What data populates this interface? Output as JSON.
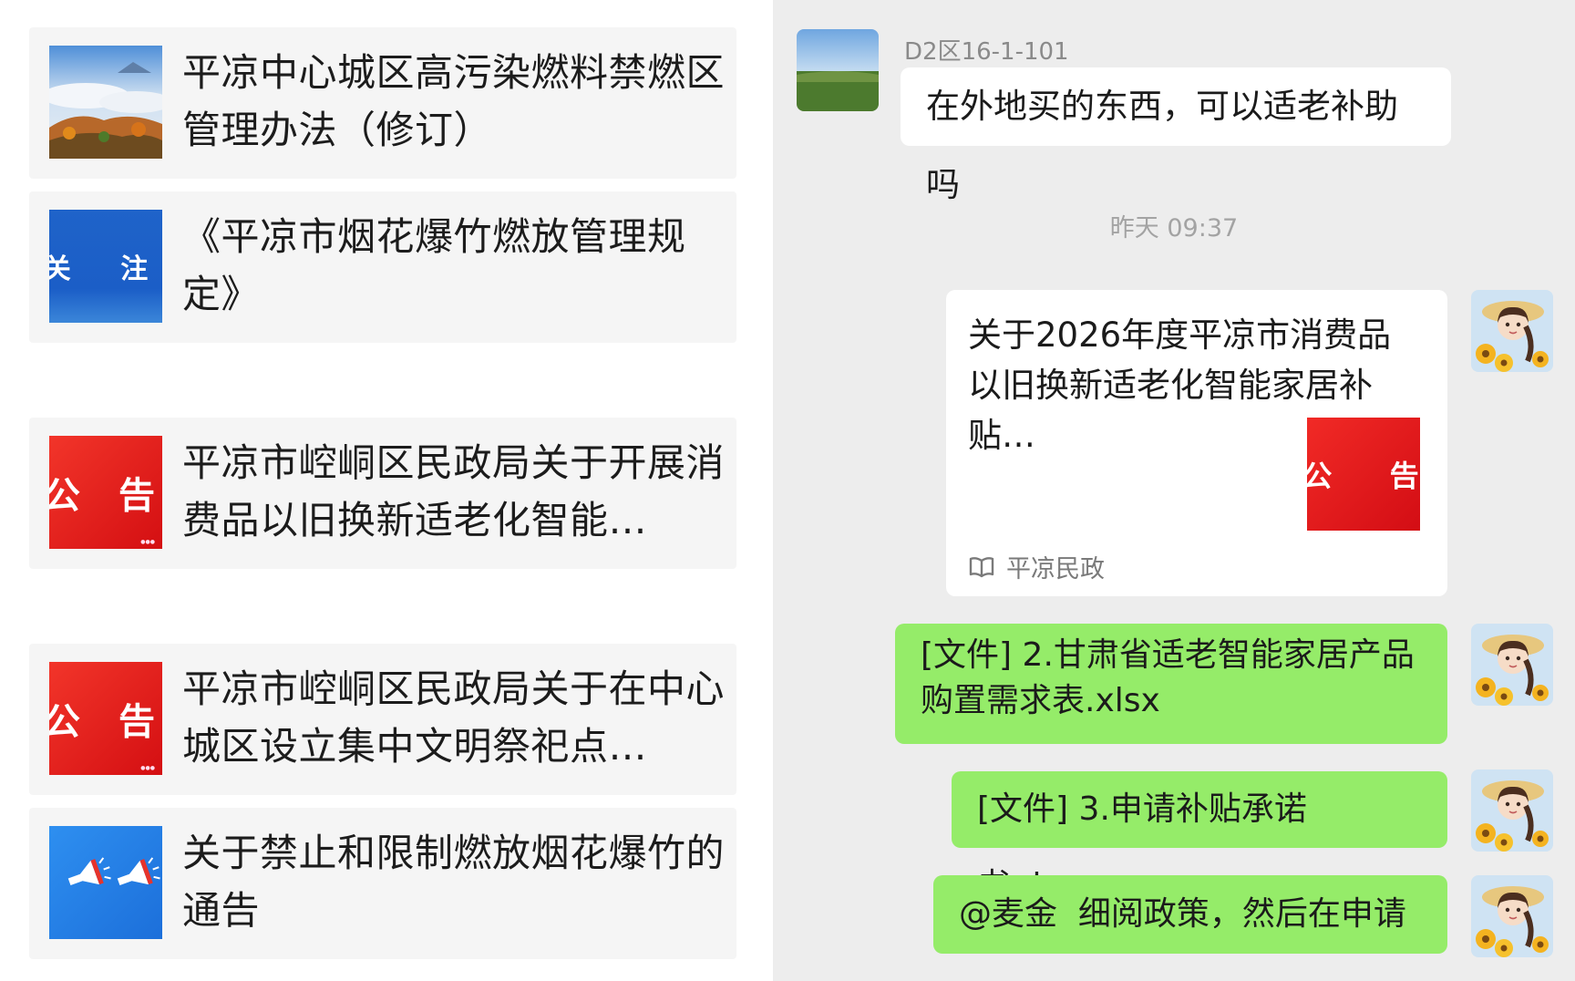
{
  "articles": [
    {
      "title": "平凉中心城区高污染燃料禁燃区管理办法（修订）",
      "thumb": "mountain-photo"
    },
    {
      "title": "《平凉市烟花爆竹燃放管理规定》",
      "thumb": "focus-badge",
      "thumb_text": "关 注"
    },
    {
      "title": "平凉市崆峒区民政局关于开展消费品以旧换新适老化智能…",
      "thumb": "notice-badge",
      "thumb_text": "公 告"
    },
    {
      "title": "平凉市崆峒区民政局关于在中心城区设立集中文明祭祀点…",
      "thumb": "notice-badge",
      "thumb_text": "公 告"
    },
    {
      "title": "关于禁止和限制燃放烟花爆竹的通告",
      "thumb": "megaphone-badge"
    }
  ],
  "chat": {
    "sender_name": "D2区16-1-101",
    "incoming_message": "在外地买的东西，可以适老补助吗",
    "timestamp": "昨天 09:37",
    "shared_article": {
      "title": "关于2026年度平凉市消费品以旧换新适老化智能家居补贴…",
      "thumb_text": "公 告",
      "source": "平凉民政",
      "source_icon": "official-account-icon"
    },
    "outgoing_messages": [
      "[文件] 2.甘肃省适老智能家居产品购置需求表.xlsx",
      "[文件] 3.申请补贴承诺书.docx",
      "@麦金  细阅政策，然后在申请"
    ]
  },
  "colors": {
    "left_bg": "#ffffff",
    "card_bg": "#f5f5f5",
    "chat_bg": "#ededed",
    "bubble_green": "#95ec69",
    "notice_red": "#e3171c",
    "focus_blue": "#1b5ec7"
  }
}
